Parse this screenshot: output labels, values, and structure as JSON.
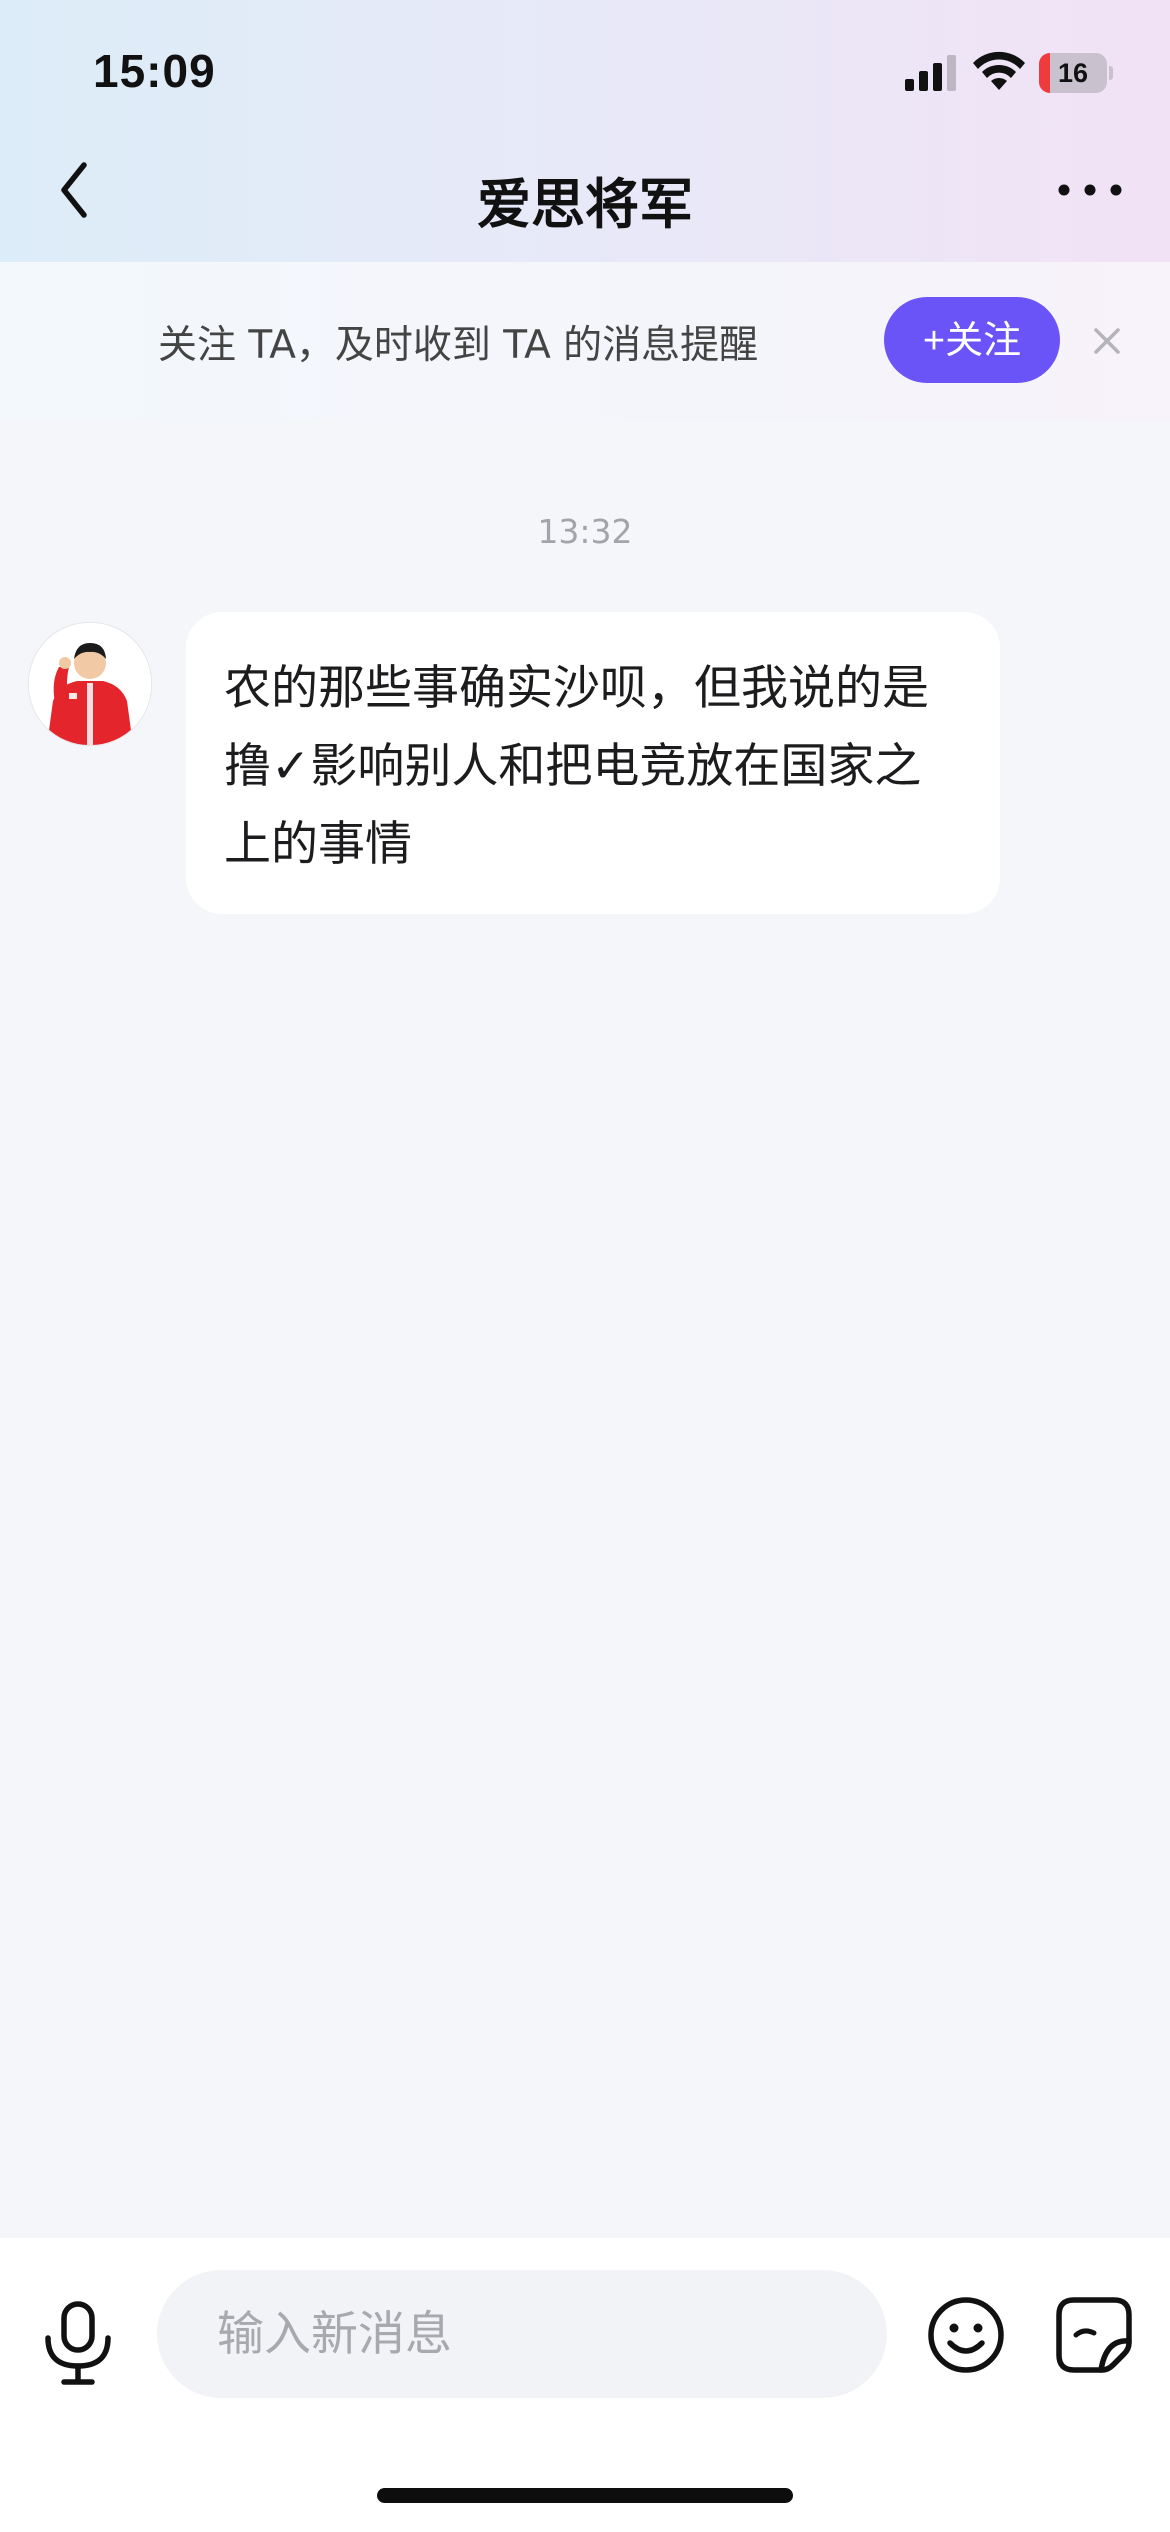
{
  "status_bar": {
    "time": "15:09",
    "battery_level": "16",
    "battery_fraction": 0.16,
    "signal_icon": "cellular-signal-icon",
    "wifi_icon": "wifi-icon"
  },
  "nav": {
    "title": "爱思将军",
    "back_icon": "chevron-left-icon",
    "more_icon": "more-dots-icon"
  },
  "follow_banner": {
    "text": "关注 TA，及时收到 TA 的消息提醒",
    "button_label": "+关注",
    "close_icon": "close-icon"
  },
  "chat": {
    "timestamp": "13:32",
    "messages": [
      {
        "sender_avatar": "avatar",
        "text": "农的那些事确实沙呗，但我说的是撸✓影响别人和把电竞放在国家之上的事情"
      }
    ]
  },
  "input_bar": {
    "placeholder": "输入新消息",
    "value": "",
    "mic_icon": "microphone-icon",
    "emoji_icon": "emoji-icon",
    "sticker_icon": "sticker-icon"
  },
  "colors": {
    "accent": "#6a54f7",
    "background": "#f5f6f9",
    "battery_low": "#ef3b3b"
  }
}
